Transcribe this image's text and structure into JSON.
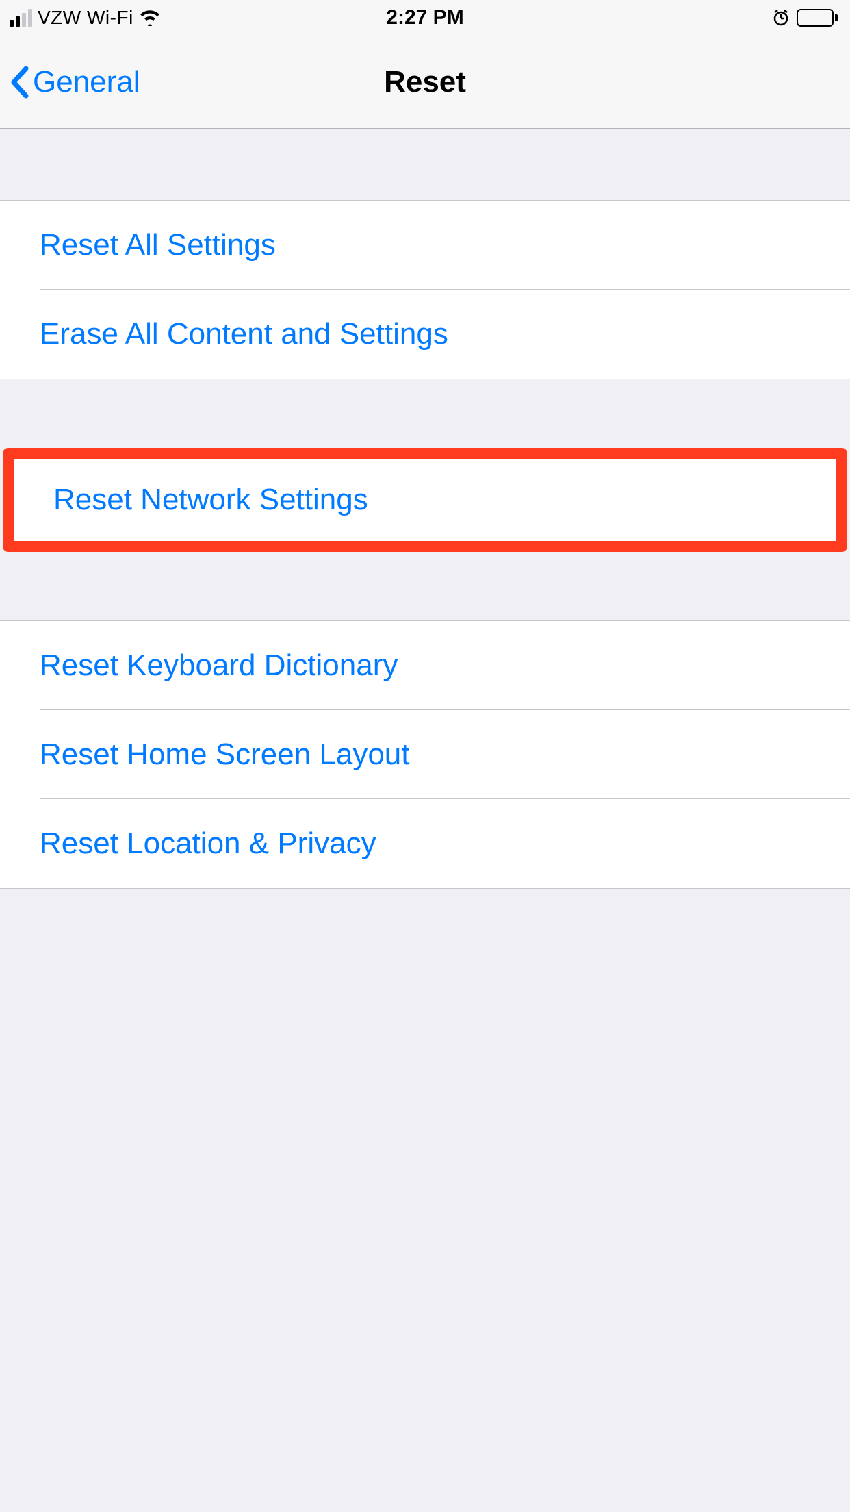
{
  "status": {
    "carrier": "VZW Wi-Fi",
    "time": "2:27 PM"
  },
  "nav": {
    "back": "General",
    "title": "Reset"
  },
  "group1": {
    "items": [
      {
        "label": "Reset All Settings"
      },
      {
        "label": "Erase All Content and Settings"
      }
    ]
  },
  "group2": {
    "items": [
      {
        "label": "Reset Network Settings"
      }
    ]
  },
  "group3": {
    "items": [
      {
        "label": "Reset Keyboard Dictionary"
      },
      {
        "label": "Reset Home Screen Layout"
      },
      {
        "label": "Reset Location & Privacy"
      }
    ]
  }
}
